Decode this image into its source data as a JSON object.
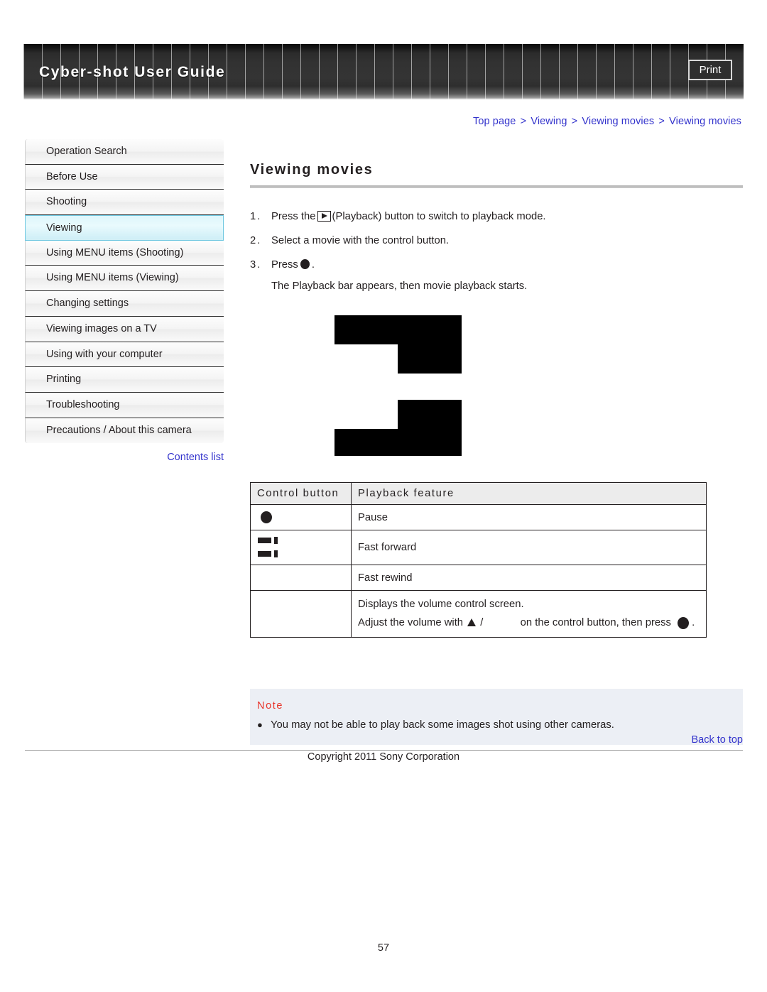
{
  "header": {
    "title": "Cyber-shot User Guide",
    "print_label": "Print"
  },
  "breadcrumb": {
    "items": [
      "Top page",
      "Viewing",
      "Viewing movies",
      "Viewing movies"
    ],
    "separator": ">"
  },
  "sidebar": {
    "items": [
      {
        "label": "Operation Search",
        "active": false
      },
      {
        "label": "Before Use",
        "active": false
      },
      {
        "label": "Shooting",
        "active": false
      },
      {
        "label": "Viewing",
        "active": true
      },
      {
        "label": "Using MENU items (Shooting)",
        "active": false
      },
      {
        "label": "Using MENU items (Viewing)",
        "active": false
      },
      {
        "label": "Changing settings",
        "active": false
      },
      {
        "label": "Viewing images on a TV",
        "active": false
      },
      {
        "label": "Using with your computer",
        "active": false
      },
      {
        "label": "Printing",
        "active": false
      },
      {
        "label": "Troubleshooting",
        "active": false
      },
      {
        "label": "Precautions / About this camera",
        "active": false
      }
    ],
    "contents_link": "Contents list"
  },
  "main": {
    "title": "Viewing movies",
    "steps": [
      {
        "num": "1.",
        "text_before": "Press the",
        "icon": "playback-icon",
        "text_after": "(Playback) button to switch to playback mode."
      },
      {
        "num": "2.",
        "text_before": "Select a movie with the control button.",
        "icon": "",
        "text_after": ""
      },
      {
        "num": "3.",
        "text_before": "Press",
        "icon": "center-dot-icon",
        "text_after": "."
      }
    ],
    "step3_detail": "The Playback bar appears, then movie playback starts.",
    "table": {
      "headers": [
        "Control button",
        "Playback feature"
      ],
      "rows": [
        {
          "icon": "center-dot-icon",
          "feature": "Pause"
        },
        {
          "icon": "fast-forward-icon",
          "feature": "Fast forward"
        },
        {
          "icon": "",
          "feature": "Fast rewind"
        },
        {
          "icon": "",
          "feature_line1": "Displays the volume control screen.",
          "feature_line2_a": "Adjust the volume with",
          "feature_line2_b": "/",
          "feature_line2_c": "on the control button, then press",
          "feature_line2_d": "."
        }
      ]
    },
    "note": {
      "title": "Note",
      "bullet": "●",
      "items": [
        "You may not be able to play back some images shot using other cameras."
      ]
    }
  },
  "footer": {
    "back_to_top": "Back to top",
    "copyright": "Copyright 2011 Sony Corporation",
    "page_number": "57"
  },
  "colors": {
    "link": "#3333cc",
    "note_title": "#e8352b",
    "active_item": "#ddf6fb",
    "text": "#231f20"
  }
}
